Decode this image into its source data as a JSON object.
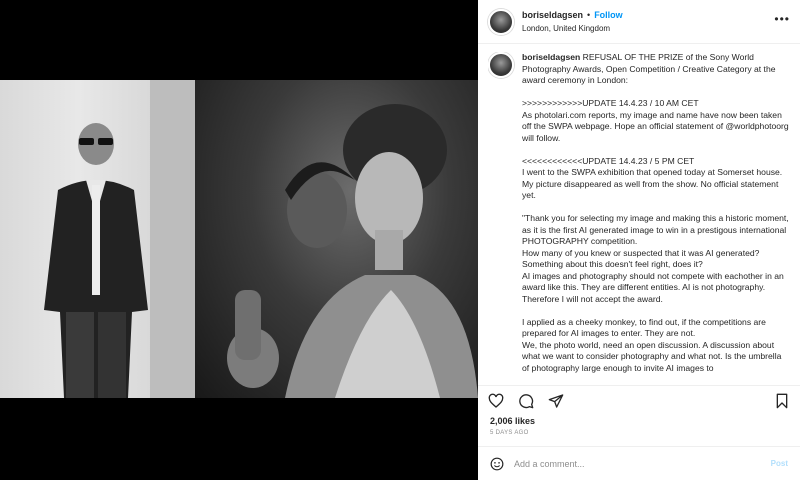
{
  "post": {
    "username": "boriseldagsen",
    "separator": "•",
    "follow_label": "Follow",
    "location": "London, United Kingdom",
    "more_icon": "more-horizontal-icon"
  },
  "caption": {
    "username": "boriseldagsen",
    "p1": "REFUSAL OF THE PRIZE of the Sony World Photography Awards, Open Competition / Creative Category at the award ceremony in London:",
    "p2": ">>>>>>>>>>>>UPDATE 14.4.23 / 10 AM CET\nAs photolari.com reports, my image and name have now been taken off the SWPA webpage. Hope an official statement of @worldphotoorg will follow.",
    "p3": "<<<<<<<<<<<<UPDATE 14.4.23 / 5 PM CET\nI went to the SWPA exhibition that opened today at Somerset house. My picture disappeared as well from the show. No official statement yet.",
    "p4": "\"Thank you for selecting my image and making this a historic moment, as it is the first AI generated image to win in a prestigous international PHOTOGRAPHY competition.\nHow many of you knew or suspected that it was AI generated? Something about this doesn't feel right, does it?\nAI images and photography should not compete with eachother in an award like this. They are different entities. AI is not photography. Therefore I will not accept the award.",
    "p5": "I applied as a cheeky monkey, to find out, if the competitions are prepared for AI images to enter. They are not.\nWe, the photo world, need an open discussion. A discussion about what we want to consider photography and what not. Is the umbrella of photography large enough to invite AI images to"
  },
  "actions": {
    "like_icon": "heart-icon",
    "comment_icon": "comment-icon",
    "share_icon": "share-icon",
    "save_icon": "bookmark-icon"
  },
  "stats": {
    "likes": "2,006 likes",
    "time": "5 DAYS AGO"
  },
  "comment": {
    "placeholder": "Add a comment...",
    "post_label": "Post",
    "emoji_icon": "emoji-icon"
  }
}
